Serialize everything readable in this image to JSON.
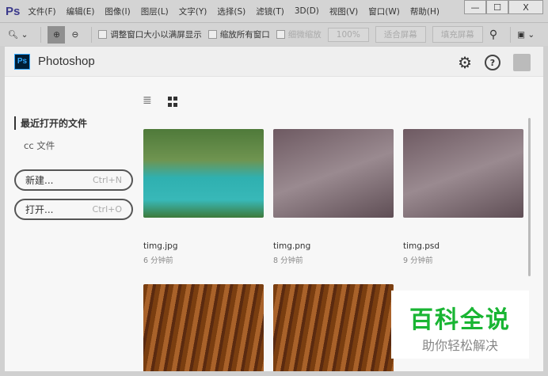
{
  "app": {
    "logo": "Ps",
    "menus": [
      "文件(F)",
      "编辑(E)",
      "图像(I)",
      "图层(L)",
      "文字(Y)",
      "选择(S)",
      "滤镜(T)",
      "3D(D)",
      "视图(V)",
      "窗口(W)",
      "帮助(H)"
    ],
    "win": {
      "min": "—",
      "max": "☐",
      "close": "X"
    }
  },
  "toolbar": {
    "resize_windows": "调整窗口大小以满屏显示",
    "zoom_all": "缩放所有窗口",
    "scrubby": "细微缩放",
    "zoom_pct": "100%",
    "fit_screen": "适合屏幕",
    "fill_screen": "填充屏幕"
  },
  "home": {
    "title": "Photoshop",
    "ps_icon": "Ps",
    "recent": "最近打开的文件",
    "cc_files": "cc 文件",
    "new_label": "新建...",
    "new_shortcut": "Ctrl+N",
    "open_label": "打开...",
    "open_shortcut": "Ctrl+O",
    "files": [
      {
        "name": "timg.jpg",
        "time": "6 分钟前"
      },
      {
        "name": "timg.png",
        "time": "8 分钟前"
      },
      {
        "name": "timg.psd",
        "time": "9 分钟前"
      }
    ]
  },
  "watermark": {
    "title": "百科全说",
    "subtitle": "助你轻松解决"
  }
}
